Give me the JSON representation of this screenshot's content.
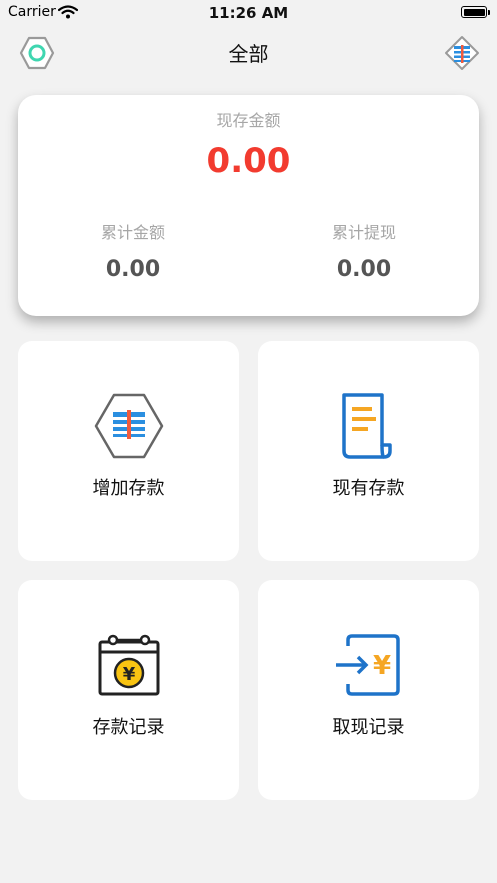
{
  "status_bar": {
    "carrier": "Carrier",
    "time": "11:26 AM"
  },
  "nav": {
    "title": "全部",
    "left_icon": "hexagon-ring-icon",
    "right_icon": "savings-box-icon"
  },
  "summary": {
    "current_label": "现存金额",
    "current_amount": "0.00",
    "total_label": "累计金额",
    "total_amount": "0.00",
    "withdraw_label": "累计提现",
    "withdraw_amount": "0.00",
    "accent_color": "#f23b2f"
  },
  "tiles": [
    {
      "label": "增加存款",
      "icon": "savings-box-icon"
    },
    {
      "label": "现有存款",
      "icon": "document-list-icon"
    },
    {
      "label": "存款记录",
      "icon": "calendar-yuan-icon"
    },
    {
      "label": "取现记录",
      "icon": "withdraw-yuan-icon"
    }
  ]
}
